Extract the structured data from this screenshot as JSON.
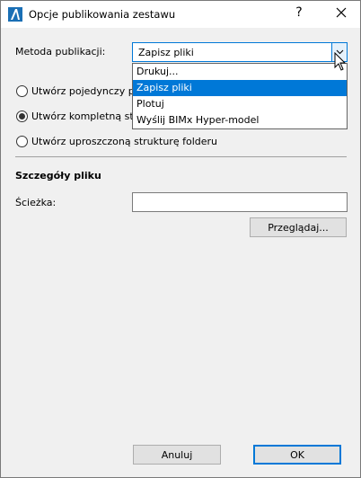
{
  "window": {
    "title": "Opcje publikowania zestawu",
    "help_label": "?"
  },
  "method": {
    "label": "Metoda publikacji:",
    "selected": "Zapisz pliki",
    "options": [
      "Drukuj...",
      "Zapisz pliki",
      "Plotuj",
      "Wyślij BIMx Hyper-model"
    ],
    "highlighted_index": 1
  },
  "structure": {
    "options": [
      {
        "label": "Utwórz pojedynczy pli",
        "checked": false
      },
      {
        "label": "Utwórz kompletną str",
        "checked": true
      },
      {
        "label": "Utwórz uproszczoną strukturę folderu",
        "checked": false
      }
    ]
  },
  "details": {
    "heading": "Szczegóły pliku",
    "path_label": "Ścieżka:",
    "path_value": "",
    "browse_label": "Przeglądaj..."
  },
  "footer": {
    "cancel_label": "Anuluj",
    "ok_label": "OK"
  },
  "colors": {
    "accent": "#0078d7",
    "dialog_bg": "#f0f0f0"
  }
}
